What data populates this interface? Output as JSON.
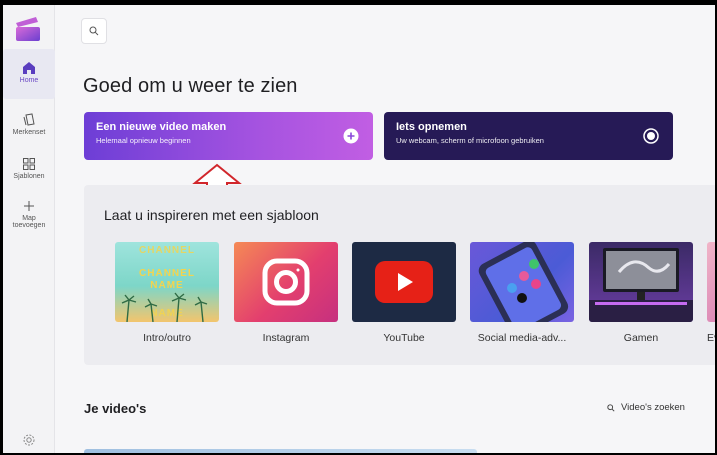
{
  "sidebar": {
    "items": [
      {
        "label": "Home",
        "icon": "home-icon"
      },
      {
        "label": "Merkenset",
        "icon": "brand-kit-icon"
      },
      {
        "label": "Sjablonen",
        "icon": "templates-icon"
      },
      {
        "label_line1": "Map",
        "label_line2": "toevoegen",
        "icon": "plus-icon"
      }
    ]
  },
  "greeting": "Goed om u weer te zien",
  "cards": {
    "new_video": {
      "title": "Een nieuwe video maken",
      "subtitle": "Helemaal opnieuw beginnen"
    },
    "record": {
      "title": "Iets opnemen",
      "subtitle": "Uw webcam, scherm of microfoon gebruiken"
    }
  },
  "templates": {
    "title": "Laat u inspireren met een sjabloon",
    "items": [
      {
        "label": "Intro/outro",
        "thumb_text": [
          "CHANNEL",
          "CHANNEL",
          "NAME",
          "NAME"
        ]
      },
      {
        "label": "Instagram"
      },
      {
        "label": "YouTube"
      },
      {
        "label": "Social media-adv..."
      },
      {
        "label": "Gamen"
      },
      {
        "label": "Ev"
      }
    ]
  },
  "videos": {
    "title": "Je video's",
    "search_label": "Video's zoeken"
  },
  "colors": {
    "accent": "#6b47c5",
    "card_new_gradient_start": "#6d3ed6",
    "card_record": "#261a56",
    "annotation_arrow": "#d1262b"
  }
}
